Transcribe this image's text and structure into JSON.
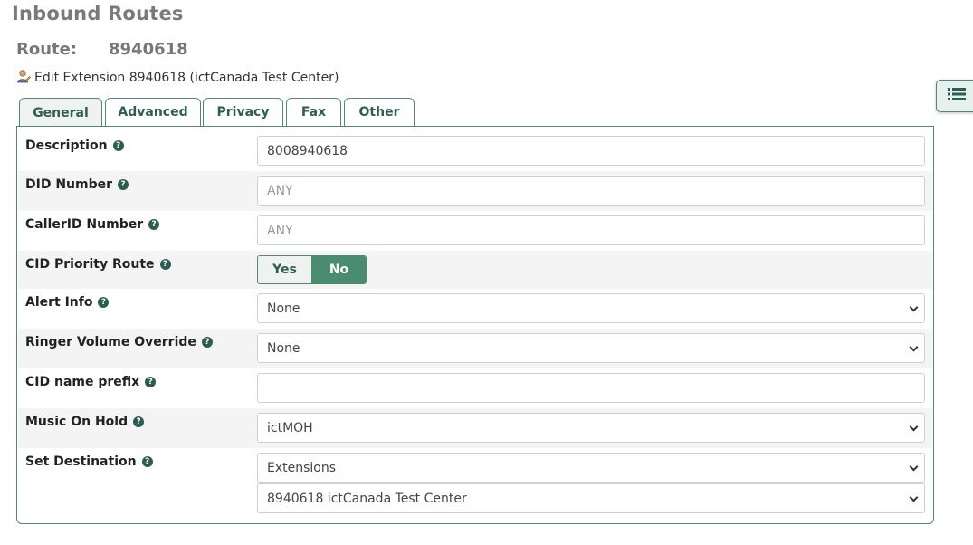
{
  "page": {
    "title": "Inbound Routes"
  },
  "route": {
    "label": "Route:",
    "value": "8940618"
  },
  "edit_link": {
    "text": "Edit Extension 8940618 (ictCanada Test Center)",
    "icon": "user-edit-icon"
  },
  "tabs": [
    {
      "label": "General",
      "active": true
    },
    {
      "label": "Advanced",
      "active": false
    },
    {
      "label": "Privacy",
      "active": false
    },
    {
      "label": "Fax",
      "active": false
    },
    {
      "label": "Other",
      "active": false
    }
  ],
  "form": {
    "description": {
      "label": "Description",
      "value": "8008940618"
    },
    "did_number": {
      "label": "DID Number",
      "placeholder": "ANY"
    },
    "callerid_number": {
      "label": "CallerID Number",
      "placeholder": "ANY"
    },
    "cid_priority_route": {
      "label": "CID Priority Route",
      "yes": "Yes",
      "no": "No",
      "selected": "No"
    },
    "alert_info": {
      "label": "Alert Info",
      "selected": "None"
    },
    "ringer_volume_override": {
      "label": "Ringer Volume Override",
      "selected": "None"
    },
    "cid_name_prefix": {
      "label": "CID name prefix",
      "value": ""
    },
    "music_on_hold": {
      "label": "Music On Hold",
      "selected": "ictMOH"
    },
    "set_destination": {
      "label": "Set Destination",
      "type": "Extensions",
      "target": "8940618 ictCanada Test Center"
    }
  },
  "side_button": {
    "icon": "list-icon"
  },
  "colors": {
    "accent": "#4a8c6f",
    "border": "#4e8a74",
    "title": "#7a7a7a",
    "help": "#2b5d52"
  }
}
